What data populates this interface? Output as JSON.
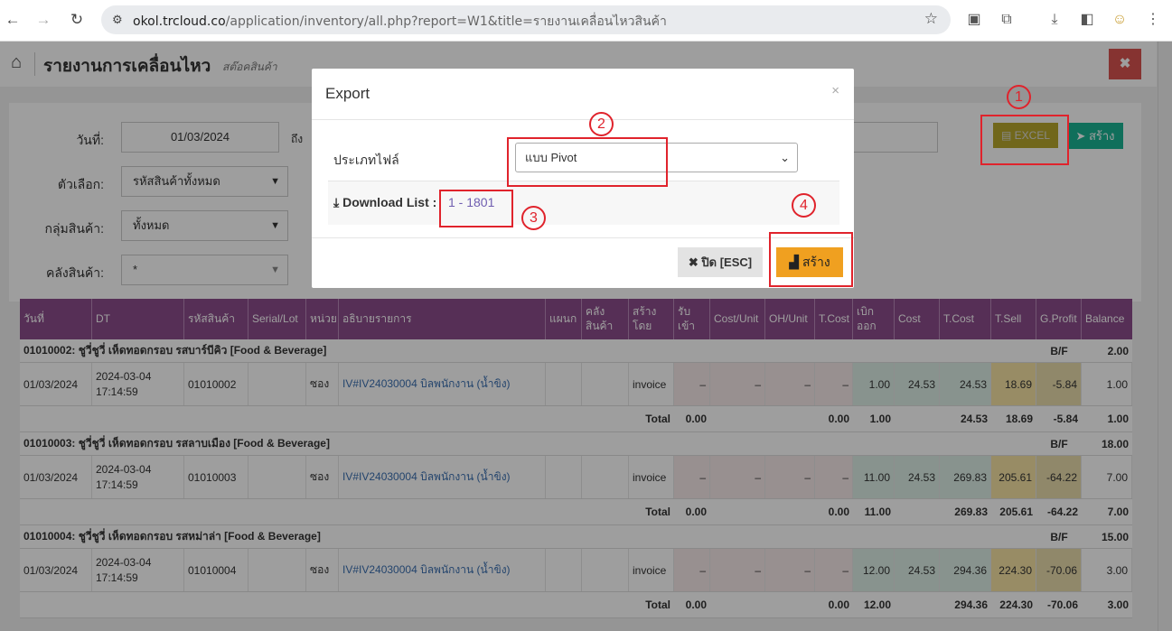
{
  "browser": {
    "url_host": "okol.trcloud.co",
    "url_path": "/application/inventory/all.php?report=W1&title=รายงานเคลื่อนไหวสินค้า"
  },
  "header": {
    "title": "รายงานการเคลื่อนไหว",
    "subtitle": "สต๊อคสินค้า",
    "close_label": "✖"
  },
  "filters": {
    "date_label": "วันที่:",
    "date_from": "01/03/2024",
    "to_label": "ถึง",
    "option_label": "ตัวเลือก:",
    "option_value": "รหัสสินค้าทั้งหมด",
    "group_label": "กลุ่มสินค้า:",
    "group_value": "ทั้งหมด",
    "warehouse_label": "คลังสินค้า:",
    "warehouse_value": "*"
  },
  "actions": {
    "excel_label": "EXCEL",
    "create_label": "สร้าง"
  },
  "table": {
    "headers": [
      "วันที่",
      "DT",
      "รหัสสินค้า",
      "Serial/Lot",
      "หน่วย",
      "อธิบายรายการ",
      "แผนก",
      "คลัง สินค้า",
      "สร้าง โดย",
      "รับ เข้า",
      "Cost/Unit",
      "OH/Unit",
      "T.Cost",
      "เบิก ออก",
      "Cost",
      "T.Cost",
      "T.Sell",
      "G.Profit",
      "Balance"
    ],
    "groups": [
      {
        "title": "01010002: ชูวี่ชูวี่ เห็ดทอดกรอบ รสบาร์บีคิว [Food & Beverage]",
        "bf_label": "B/F",
        "bf_value": "2.00",
        "row": {
          "date": "01/03/2024",
          "dt1": "2024-03-04",
          "dt2": "17:14:59",
          "code": "01010002",
          "unit": "ซอง",
          "desc": "IV#IV24030004 บิลพนักงาน (น้ำขิง)",
          "by": "invoice",
          "in": "–",
          "cu": "–",
          "oh": "–",
          "tc": "–",
          "out": "1.00",
          "cost": "24.53",
          "tcost": "24.53",
          "sell": "18.69",
          "gp": "-5.84",
          "bal": "1.00"
        },
        "total": {
          "label": "Total",
          "in": "0.00",
          "tc": "0.00",
          "out": "1.00",
          "tcost": "24.53",
          "sell": "18.69",
          "gp": "-5.84",
          "bal": "1.00"
        }
      },
      {
        "title": "01010003: ชูวี่ชูวี่ เห็ดทอดกรอบ รสลาบเมือง [Food & Beverage]",
        "bf_label": "B/F",
        "bf_value": "18.00",
        "row": {
          "date": "01/03/2024",
          "dt1": "2024-03-04",
          "dt2": "17:14:59",
          "code": "01010003",
          "unit": "ซอง",
          "desc": "IV#IV24030004 บิลพนักงาน (น้ำขิง)",
          "by": "invoice",
          "in": "–",
          "cu": "–",
          "oh": "–",
          "tc": "–",
          "out": "11.00",
          "cost": "24.53",
          "tcost": "269.83",
          "sell": "205.61",
          "gp": "-64.22",
          "bal": "7.00"
        },
        "total": {
          "label": "Total",
          "in": "0.00",
          "tc": "0.00",
          "out": "11.00",
          "tcost": "269.83",
          "sell": "205.61",
          "gp": "-64.22",
          "bal": "7.00"
        }
      },
      {
        "title": "01010004: ชูวี่ชูวี่ เห็ดทอดกรอบ รสหม่าล่า [Food & Beverage]",
        "bf_label": "B/F",
        "bf_value": "15.00",
        "row": {
          "date": "01/03/2024",
          "dt1": "2024-03-04",
          "dt2": "17:14:59",
          "code": "01010004",
          "unit": "ซอง",
          "desc": "IV#IV24030004 บิลพนักงาน (น้ำขิง)",
          "by": "invoice",
          "in": "–",
          "cu": "–",
          "oh": "–",
          "tc": "–",
          "out": "12.00",
          "cost": "24.53",
          "tcost": "294.36",
          "sell": "224.30",
          "gp": "-70.06",
          "bal": "3.00"
        },
        "total": {
          "label": "Total",
          "in": "0.00",
          "tc": "0.00",
          "out": "12.00",
          "tcost": "294.36",
          "sell": "224.30",
          "gp": "-70.06",
          "bal": "3.00"
        }
      }
    ]
  },
  "modal": {
    "title": "Export",
    "close_x": "×",
    "file_type_label": "ประเภทไฟล์",
    "file_type_value": "แบบ Pivot",
    "download_label": "Download List :",
    "download_range": "1 - 1801",
    "close_button": "ปิด [ESC]",
    "create_button": "สร้าง"
  },
  "annotations": {
    "step1": "1",
    "step2": "2",
    "step3": "3",
    "step4": "4",
    "color": "#e0232c"
  }
}
